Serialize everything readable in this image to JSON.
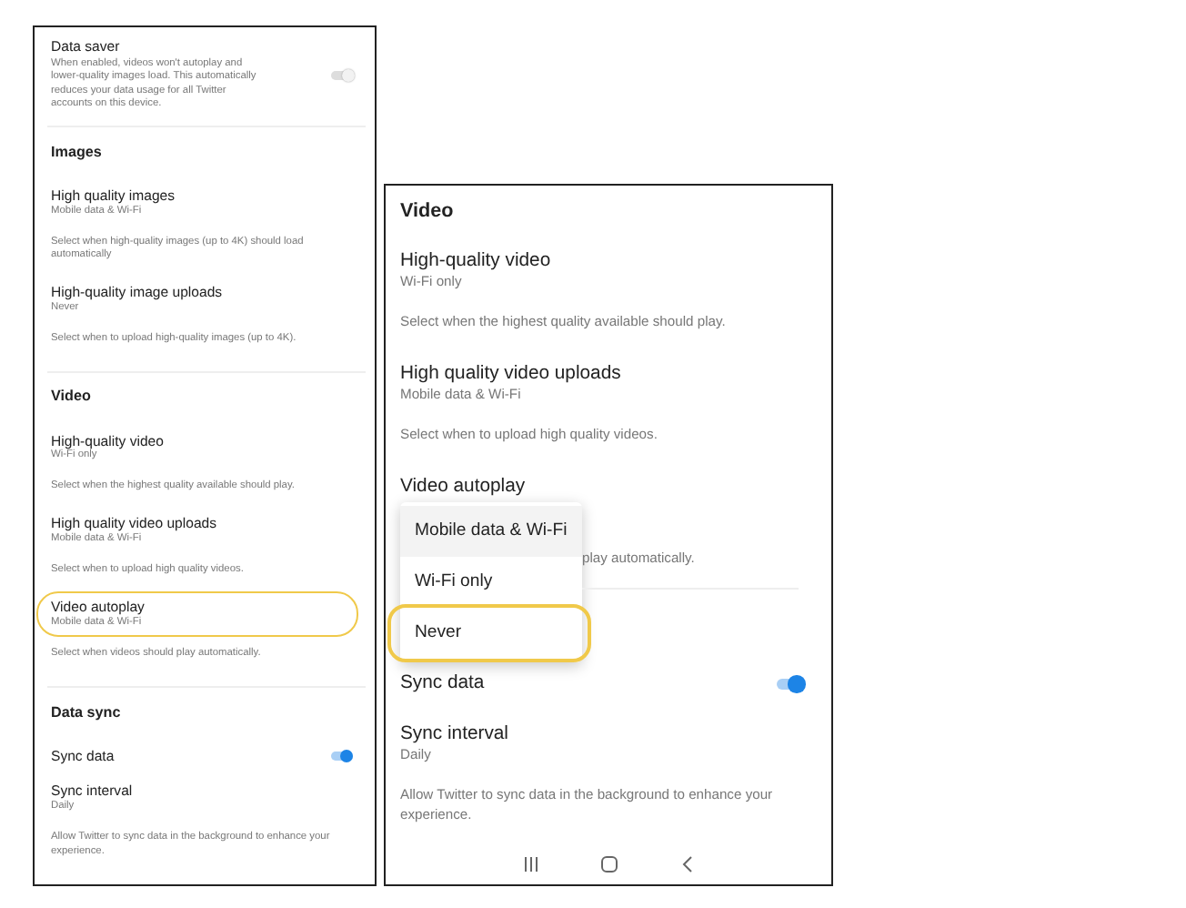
{
  "screens": [
    {
      "nav_bar": false,
      "sections": [
        {
          "items": [
            {
              "kind": "toggle",
              "title": "Data saver",
              "description": "When enabled, videos won't autoplay and lower-quality images load. This automatically reduces your data usage for all Twitter accounts on this device.",
              "on": false
            }
          ]
        },
        {
          "items": [
            {
              "kind": "header",
              "title": "Images"
            },
            {
              "kind": "setting",
              "title": "High quality images",
              "value": "Mobile data & Wi-Fi",
              "highlighted": false
            },
            {
              "kind": "note",
              "text": "Select when high-quality images (up to 4K) should load automatically"
            },
            {
              "kind": "setting",
              "title": "High-quality image uploads",
              "value": "Never",
              "highlighted": false
            },
            {
              "kind": "note",
              "text": "Select when to upload high-quality images (up to 4K)."
            }
          ]
        },
        {
          "items": [
            {
              "kind": "header",
              "title": "Video"
            },
            {
              "kind": "setting",
              "title": "High-quality video",
              "value": "Wi-Fi only",
              "highlighted": false
            },
            {
              "kind": "note",
              "text": "Select when the highest quality available should play."
            },
            {
              "kind": "setting",
              "title": "High quality video uploads",
              "value": "Mobile data & Wi-Fi",
              "highlighted": false
            },
            {
              "kind": "note",
              "text": "Select when to upload high quality videos."
            },
            {
              "kind": "setting",
              "title": "Video autoplay",
              "value": "Mobile data & Wi-Fi",
              "highlighted": true
            },
            {
              "kind": "note",
              "text": "Select when videos should play automatically."
            }
          ]
        },
        {
          "items": [
            {
              "kind": "header",
              "title": "Data sync"
            },
            {
              "kind": "toggle",
              "title": "Sync data",
              "on": true
            },
            {
              "kind": "setting",
              "title": "Sync interval",
              "value": "Daily",
              "highlighted": false
            },
            {
              "kind": "note",
              "text": "Allow Twitter to sync data in the background to enhance your experience."
            }
          ]
        }
      ]
    },
    {
      "nav_bar": true,
      "sections": [
        {
          "items": [
            {
              "kind": "header",
              "title": "Video"
            },
            {
              "kind": "setting",
              "title": "High-quality video",
              "value": "Wi-Fi only",
              "highlighted": false
            },
            {
              "kind": "note",
              "text": "Select when the highest quality available should play."
            },
            {
              "kind": "setting",
              "title": "High quality video uploads",
              "value": "Mobile data & Wi-Fi",
              "highlighted": false
            },
            {
              "kind": "note",
              "text": "Select when to upload high quality videos."
            },
            {
              "kind": "setting",
              "title": "Video autoplay",
              "highlighted": false
            },
            {
              "kind": "dropdown",
              "note": "play automatically.",
              "options": [
                {
                  "label": "Mobile data & Wi-Fi",
                  "highlighted": false
                },
                {
                  "label": "Wi-Fi only",
                  "highlighted": false
                },
                {
                  "label": "Never",
                  "highlighted": true
                }
              ]
            },
            {
              "kind": "toggle",
              "title": "Sync data",
              "on": true
            },
            {
              "kind": "setting",
              "title": "Sync interval",
              "value": "Daily",
              "highlighted": false
            },
            {
              "kind": "note",
              "text": "Allow Twitter to sync data in the background to enhance your experience."
            }
          ]
        }
      ]
    }
  ]
}
